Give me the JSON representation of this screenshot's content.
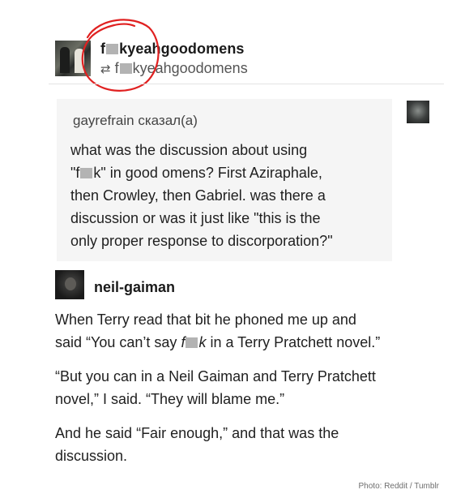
{
  "header": {
    "username_prefix": "f",
    "username_suffix": "kyeahgoodomens",
    "reblog_prefix": "f",
    "reblog_suffix": "kyeahgoodomens",
    "reblog_icon": "reblog-icon",
    "annotation_color": "#e02020"
  },
  "question": {
    "asker": "gayrefrain",
    "said": "сказал(а)",
    "lines": [
      "what was the discussion about using",
      "\"f",
      "k\" in good omens? First Aziraphale,",
      "then Crowley, then Gabriel. was there a",
      "discussion or was it just like \"this is the",
      "only proper response to discorporation?\""
    ]
  },
  "answer": {
    "username": "neil-gaiman",
    "p1_line1": "When Terry read that bit he phoned me up and",
    "p1_line2_a": "said “You can’t say ",
    "p1_line2_f": "f",
    "p1_line2_k": "k",
    "p1_line2_b": " in a Terry Pratchett novel.”",
    "p2_line1": "“But you can in a Neil Gaiman and Terry Pratchett",
    "p2_line2": "novel,” I said. “They will blame me.”",
    "p3_line1": "And he said “Fair enough,” and that was the",
    "p3_line2": "discussion."
  },
  "credit": "Photo: Reddit / Tumblr"
}
